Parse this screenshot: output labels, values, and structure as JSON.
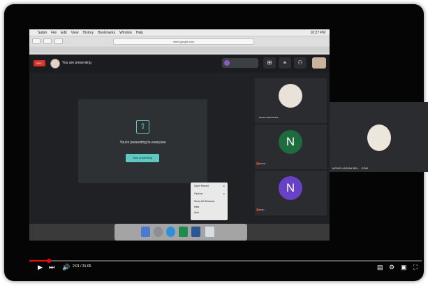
{
  "mac": {
    "menu": [
      "Safari",
      "File",
      "Edit",
      "View",
      "History",
      "Bookmarks",
      "Window",
      "Help"
    ],
    "clock": "10:27 PM"
  },
  "browser": {
    "url": "meet.google.com"
  },
  "meet": {
    "rec": "REC",
    "presenting_label": "You are presenting",
    "chip_text": [
      "",
      ""
    ],
    "present_message": "You're presenting to everyone",
    "stop_button": "Stop presenting"
  },
  "participants": [
    {
      "name": "MOHD HARIAN BIN ...",
      "avatar_letter": "",
      "avatar_color": "#e9e2d8"
    },
    {
      "name": "NOOR ...",
      "avatar_letter": "N",
      "avatar_color": "#1e6b3e"
    },
    {
      "name": "NOR ...",
      "avatar_letter": "N",
      "avatar_color": "#6742c7"
    }
  ],
  "context_menu": {
    "items": [
      "Open Recent",
      "Options",
      "Show All Windows",
      "Hide",
      "Quit"
    ]
  },
  "right_panel": {
    "name": "MOHD HARIAN BIN ... SOM"
  },
  "player": {
    "time": "2:01 / 31:00",
    "progress": 0.05
  }
}
